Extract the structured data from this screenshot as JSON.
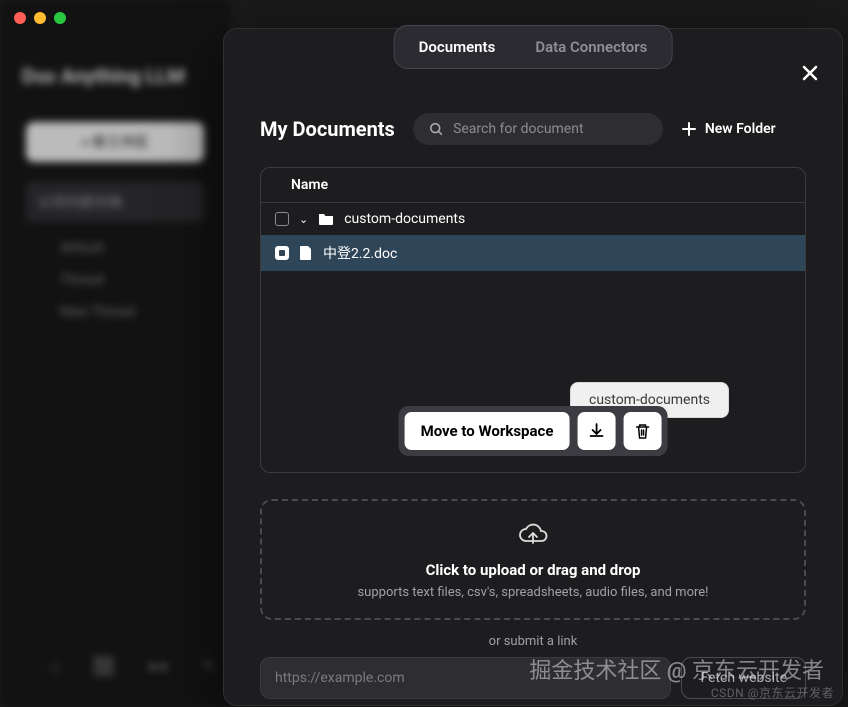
{
  "window": {
    "brand": "D∞ Anything LLM"
  },
  "sidebar": {
    "new_workspace": "+  新工作区",
    "workspace": "公司内部文档",
    "threads": [
      "default",
      "Thread",
      "New Thread"
    ]
  },
  "modal": {
    "tabs": {
      "documents": "Documents",
      "connectors": "Data Connectors"
    },
    "title": "My Documents",
    "search_placeholder": "Search for document",
    "new_folder": "New Folder",
    "table": {
      "header_name": "Name",
      "folder_name": "custom-documents",
      "file_name": "中登2.2.doc"
    },
    "tooltip": "custom-documents",
    "actions": {
      "move": "Move to Workspace"
    },
    "upload": {
      "title": "Click to upload or drag and drop",
      "subtitle": "supports text files, csv's, spreadsheets, audio files, and more!"
    },
    "submit_label": "or submit a link",
    "url_placeholder": "https://example.com",
    "fetch": "Fetch website"
  },
  "watermark": {
    "line1": "掘金技术社区 @ 京东云开发者",
    "line2": "CSDN @京东云开发者"
  }
}
